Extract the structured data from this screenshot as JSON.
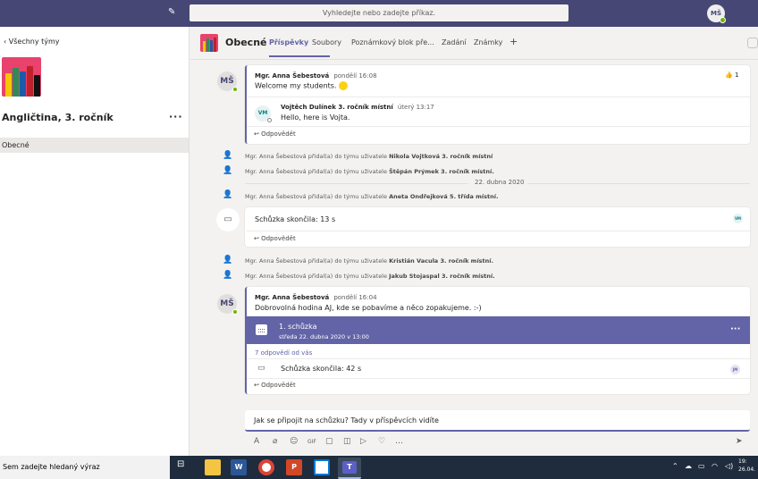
{
  "search": {
    "placeholder": "Vyhledejte nebo zadejte příkaz."
  },
  "user": {
    "initials": "MŠ"
  },
  "sidebar": {
    "back_label": "Všechny týmy",
    "team_name": "Angličtina, 3. ročník",
    "more_label": "···",
    "channels": [
      {
        "label": "Obecné"
      }
    ]
  },
  "channel": {
    "title": "Obecné"
  },
  "tabs": [
    {
      "label": "Příspěvky"
    },
    {
      "label": "Soubory"
    },
    {
      "label": "Poznámkový blok pře..."
    },
    {
      "label": "Zadání"
    },
    {
      "label": "Známky"
    },
    {
      "label": "+"
    }
  ],
  "messages": {
    "m1": {
      "initials": "MŠ",
      "sender": "Mgr. Anna Šebestová",
      "time": "pondělí 16:08",
      "text": "Welcome my students.",
      "reaction_count": "1",
      "reply": {
        "initials": "VM",
        "sender": "Vojtěch Dulínek 3. ročník místní",
        "time": "úterý 13:17",
        "text": "Hello, here is Vojta."
      },
      "reply_label": "Odpovědět"
    },
    "sys1": {
      "actor": "Mgr. Anna Šebestová",
      "verb": "přidal(a) do týmu uživatele",
      "target": "Nikola Vojtková 3. ročník místní"
    },
    "sys2": {
      "actor": "Mgr. Anna Šebestová",
      "verb": "přidal(a) do týmu uživatele",
      "target": "Štěpán Prýmek 3. ročník místní."
    },
    "date_sep": "22. dubna 2020",
    "sys3": {
      "actor": "Mgr. Anna Šebestová",
      "verb": "přidal(a) do týmu uživatele",
      "target": "Aneta Ondřejková 5. třída místní."
    },
    "meet1": {
      "title": "Schůzka skončila: 13 s",
      "chip": "VM",
      "reply_label": "Odpovědět"
    },
    "sys4": {
      "actor": "Mgr. Anna Šebestová",
      "verb": "přidal(a) do týmu uživatele",
      "target": "Kristián Vacula 3. ročník místní."
    },
    "sys5": {
      "actor": "Mgr. Anna Šebestová",
      "verb": "přidal(a) do týmu uživatele",
      "target": "Jakub Stojaspal 3. ročník místní."
    },
    "m2": {
      "initials": "MŠ",
      "sender": "Mgr. Anna Šebestová",
      "time": "pondělí 16:04",
      "text": "Dobrovolná hodina AJ, kde se pobavíme a něco zopakujeme. :-)",
      "meeting_title": "1. schůzka",
      "meeting_when": "středa 22. dubna 2020 v 13:00",
      "more": "···",
      "replies_count": "7 odpovědí od vás",
      "ended": "Schůzka skončila: 42 s",
      "chip": "JM",
      "reply_label": "Odpovědět"
    }
  },
  "compose": {
    "text": "Jak se připojit na schůzku? Tady v příspěvcích vidíte"
  },
  "taskbar": {
    "search_placeholder": "Sem zadejte hledaný výraz",
    "time": "19:",
    "date": "26.04."
  },
  "colors": {
    "brand": "#464775",
    "accent": "#6264a7",
    "team": "#e9426c"
  }
}
